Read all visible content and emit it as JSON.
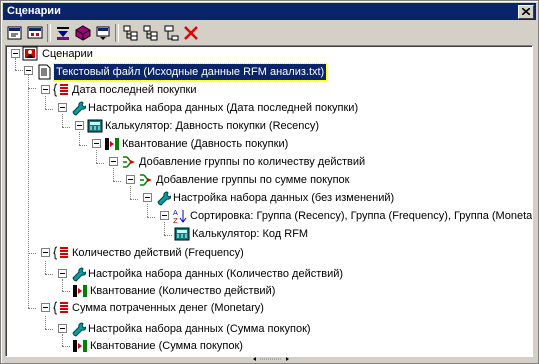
{
  "window": {
    "title": "Сценарии"
  },
  "tree": {
    "root": "Сценарии",
    "file": "Текстовый файл (Исходные данные RFM анализ.txt)",
    "n1": "Дата последней покупки",
    "n1a": "Настройка набора данных (Дата последней покупки)",
    "n1b": "Калькулятор: Давность покупки (Recency)",
    "n1c": "Квантование (Давность покупки)",
    "n1d": "Добавление группы по количеству действий",
    "n1e": "Добавление группы по сумме покупок",
    "n1f": "Настройка набора данных (без изменений)",
    "n1g": "Сортировка: Группа (Recency), Группа (Frequency), Группа (Monetary)",
    "n1h": "Калькулятор: Код RFM",
    "n2": "Количество действий (Frequency)",
    "n2a": "Настройка набора данных (Количество действий)",
    "n2b": "Квантование (Количество действий)",
    "n3": "Сумма потраченных денег (Monetary)",
    "n3a": "Настройка набора данных (Сумма покупок)",
    "n3b": "Квантование (Сумма покупок)"
  }
}
